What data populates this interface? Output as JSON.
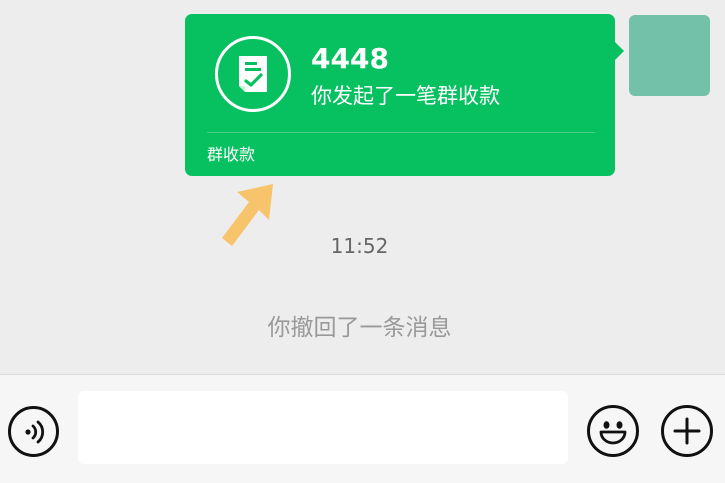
{
  "card": {
    "amount": "4448",
    "description": "你发起了一笔群收款",
    "footer_label": "群收款",
    "icon": "receipt-check-icon",
    "color": "#07c160"
  },
  "avatar": {
    "color": "#72c1a8"
  },
  "annotation": {
    "icon": "arrow-up-right-icon",
    "color": "#f7c46c"
  },
  "timestamp": "11:52",
  "recall_notice": "你撤回了一条消息",
  "input_bar": {
    "text_value": "",
    "voice_icon": "voice-icon",
    "emoji_icon": "emoji-smile-icon",
    "plus_icon": "plus-icon"
  }
}
